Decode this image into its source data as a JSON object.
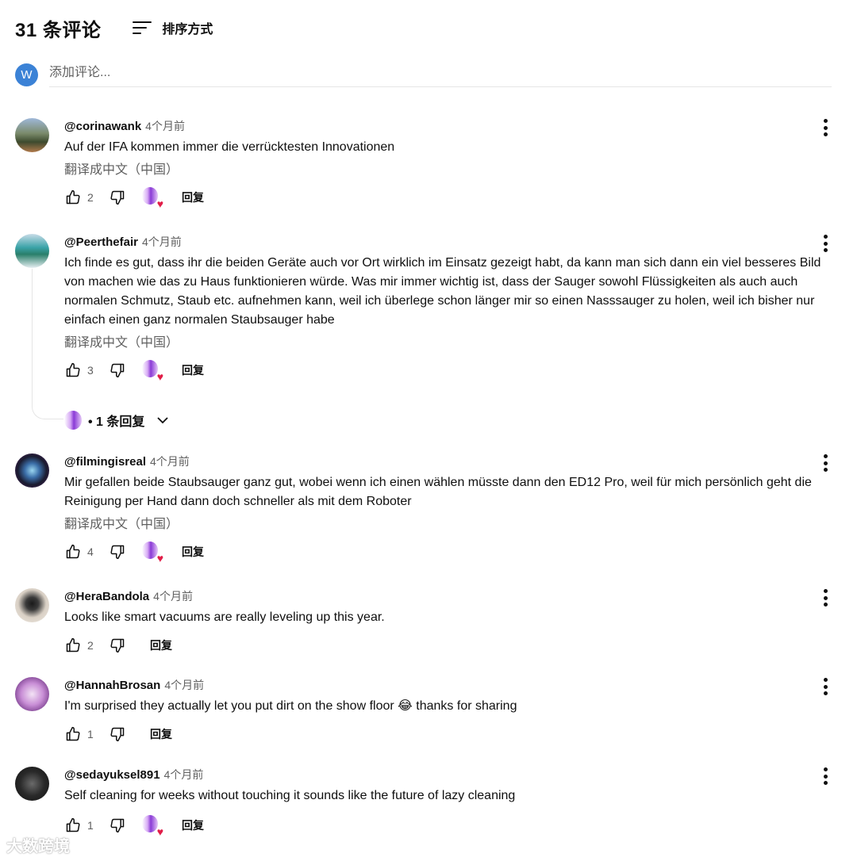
{
  "header": {
    "count_label": "31 条评论",
    "sort_label": "排序方式"
  },
  "add_comment": {
    "avatar_letter": "W",
    "placeholder": "添加评论..."
  },
  "comments": [
    {
      "author": "@corinawank",
      "time": "4个月前",
      "text": "Auf der IFA kommen immer die verrücktesten Innovationen",
      "translate": "翻译成中文（中国）",
      "likes": "2",
      "reply_label": "回复"
    },
    {
      "author": "@Peerthefair",
      "time": "4个月前",
      "text": "Ich finde es gut, dass ihr die beiden Geräte auch vor Ort wirklich im Einsatz gezeigt habt, da kann man sich dann ein viel besseres Bild von machen wie das zu Haus funktionieren würde. Was mir immer wichtig ist, dass der Sauger sowohl Flüssigkeiten als auch auch normalen Schmutz, Staub etc. aufnehmen kann, weil ich überlege schon länger mir so einen Nasssauger zu holen, weil ich bisher nur einfach einen ganz normalen Staubsauger habe",
      "translate": "翻译成中文（中国）",
      "likes": "3",
      "reply_label": "回复",
      "replies_label": "• 1 条回复"
    },
    {
      "author": "@filmingisreal",
      "time": "4个月前",
      "text": "Mir gefallen beide Staubsauger ganz gut, wobei wenn ich einen wählen müsste dann den ED12 Pro, weil für mich persönlich geht die Reinigung per Hand dann doch schneller als mit dem Roboter",
      "translate": "翻译成中文（中国）",
      "likes": "4",
      "reply_label": "回复"
    },
    {
      "author": "@HeraBandola",
      "time": "4个月前",
      "text": "Looks like smart vacuums are really leveling up this year.",
      "likes": "2",
      "reply_label": "回复"
    },
    {
      "author": "@HannahBrosan",
      "time": "4个月前",
      "text": "I'm surprised they actually let you put dirt on the show floor 😂 thanks for sharing",
      "likes": "1",
      "reply_label": "回复"
    },
    {
      "author": "@sedayuksel891",
      "time": "4个月前",
      "text": "Self cleaning for weeks without touching it sounds like the future of lazy cleaning",
      "likes": "1",
      "reply_label": "回复"
    }
  ],
  "icons": {
    "like": "thumb-up-icon",
    "dislike": "thumb-down-icon",
    "more": "more-vert-icon",
    "sort": "sort-icon",
    "heart": "creator-heart-icon",
    "expand": "chevron-down-icon"
  },
  "colors": {
    "primary_text": "#0f0f0f",
    "secondary_text": "#606060",
    "avatar_blue": "#3b82d6",
    "heart_red": "#e11d48"
  },
  "watermark": "大数跨境"
}
